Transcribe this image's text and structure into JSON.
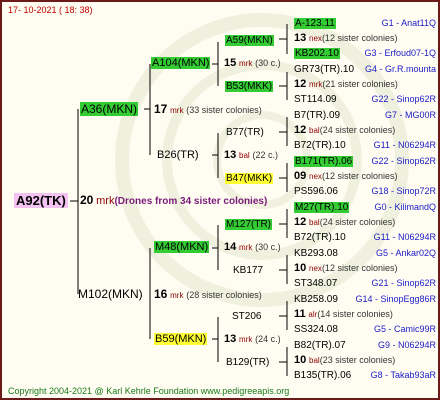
{
  "header": {
    "date": "17- 10-2021 ( 18: 38)"
  },
  "footer": {
    "copyright": "Copyright 2004-2021 @ Karl Kehrle Foundation    www.pedigreeapis.org"
  },
  "root": {
    "name": "A92(TK)",
    "count": "20",
    "unit": "mrk",
    "note": "(Drones from 34 sister colonies)"
  },
  "gen1": [
    {
      "name": "A36(MKN)",
      "count": "17",
      "unit": "mrk",
      "note": "(33 sister colonies)"
    },
    {
      "name": "M102(MKN)",
      "count": "16",
      "unit": "mrk",
      "note": "(28 sister colonies)"
    }
  ],
  "gen2": [
    {
      "name": "A104(MKN)",
      "count": "15",
      "unit": "mrk",
      "note": "(30 c.)"
    },
    {
      "name": "B26(TR)",
      "count": "13",
      "unit": "bal",
      "note": "(22 c.)"
    },
    {
      "name": "M48(MKN)",
      "count": "14",
      "unit": "mrk",
      "note": "(30 c.)"
    },
    {
      "name": "B59(MKN)",
      "count": "13",
      "unit": "mrk",
      "note": "(24 c.)"
    }
  ],
  "gen3": [
    {
      "name": "A59(MKN)"
    },
    {
      "name": "B53(MKK)"
    },
    {
      "name": "B77(TR)"
    },
    {
      "name": "B47(MKK)"
    },
    {
      "name": "M127(TR)"
    },
    {
      "name": "KB177"
    },
    {
      "name": "ST206"
    },
    {
      "name": "B129(TR)"
    }
  ],
  "gen4": [
    {
      "name": "A-123.11",
      "right": "G1 - Anat11Q"
    },
    {
      "count": "13",
      "unit": "nex",
      "note": "(12 sister colonies)"
    },
    {
      "name": "KB202.10",
      "right": "G3 - Erfoud07-1Q"
    },
    {
      "name": "GR73(TR).10",
      "right": "G4 - Gr.R.mounta"
    },
    {
      "count": "12",
      "unit": "mrk",
      "note": "(21 sister colonies)"
    },
    {
      "name": "ST114.09",
      "right": "G22 - Sinop62R"
    },
    {
      "name": "B7(TR).09",
      "right": "G7 - MG00R"
    },
    {
      "count": "12",
      "unit": "bal",
      "note": "(24 sister colonies)"
    },
    {
      "name": "B72(TR).10",
      "right": "G11 - N06294R"
    },
    {
      "name": "B171(TR).06",
      "right": "G22 - Sinop62R"
    },
    {
      "count": "09",
      "unit": "nex",
      "note": "(12 sister colonies)"
    },
    {
      "name": "PS596.06",
      "right": "G18 - Sinop72R"
    },
    {
      "name": "M27(TR).10",
      "right": "G0 - KilimandQ"
    },
    {
      "count": "12",
      "unit": "bal",
      "note": "(24 sister colonies)"
    },
    {
      "name": "B72(TR).10",
      "right": "G11 - N06294R"
    },
    {
      "name": "KB293.08",
      "right": "G5 - Ankar02Q"
    },
    {
      "count": "10",
      "unit": "nex",
      "note": "(12 sister colonies)"
    },
    {
      "name": "ST348.07",
      "right": "G21 - Sinop62R"
    },
    {
      "name": "KB258.09",
      "right": "G14 - SinopEgg86R"
    },
    {
      "count": "11",
      "unit": "alr",
      "note": "(14 sister colonies)"
    },
    {
      "name": "SS324.08",
      "right": "G5 - Camic99R"
    },
    {
      "name": "B82(TR).07",
      "right": "G9 - N06294R"
    },
    {
      "count": "10",
      "unit": "bal",
      "note": "(23 sister colonies)"
    },
    {
      "name": "B135(TR).06",
      "right": "G8 - Takab93aR"
    }
  ],
  "colors": {
    "green": "#33cc33",
    "yellow": "#ffff33",
    "pink": "#f4c2f0",
    "frame": "#6b1a1a",
    "link": "#1a1ac8"
  }
}
